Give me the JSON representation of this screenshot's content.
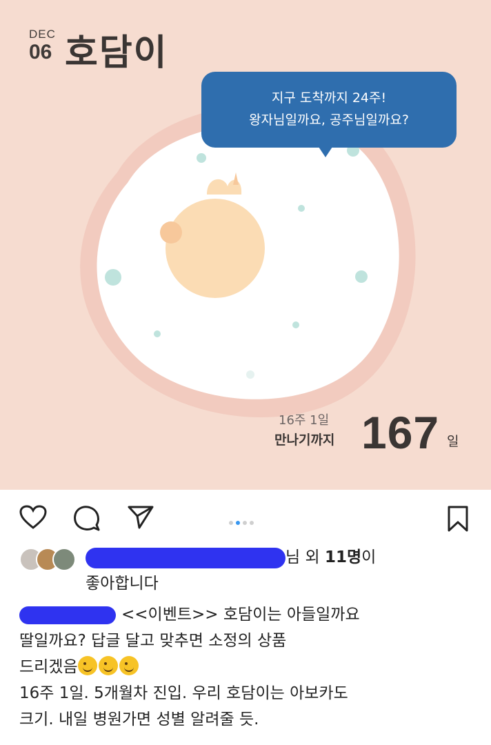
{
  "post_image": {
    "date_month": "DEC",
    "date_day": "06",
    "nickname": "호담이",
    "bubble_line1": "지구 도착까지 24주!",
    "bubble_line2": "왕자님일까요, 공주님일까요?",
    "week_text": "16주 1일",
    "until_label": "만나기까지",
    "days_count": "167",
    "days_unit": "일"
  },
  "action_bar": {
    "icons": [
      "heart-icon",
      "comment-icon",
      "share-icon",
      "bookmark-icon"
    ],
    "carousel_dots": 4,
    "active_dot": 1
  },
  "likes": {
    "suffix_text": "님 외 ",
    "count": "11명",
    "count_suffix": "이",
    "line2": "좋아합니다"
  },
  "caption": {
    "line1_text": "<<이벤트>> 호담이는 아들일까요",
    "line2": "딸일까요? 답글 달고 맞추면 소정의 상품",
    "line3_text": "드리겠음",
    "line4": "16주 1일. 5개월차 진입. 우리 호담이는 아보카도",
    "line5": "크기. 내일 병원가면 성별 알려줄 듯."
  },
  "colors": {
    "background_pink": "#f6dcd0",
    "bubble_blue": "#2f6eae",
    "redaction_blue": "#2f33f0",
    "active_dot": "#3897f0"
  }
}
